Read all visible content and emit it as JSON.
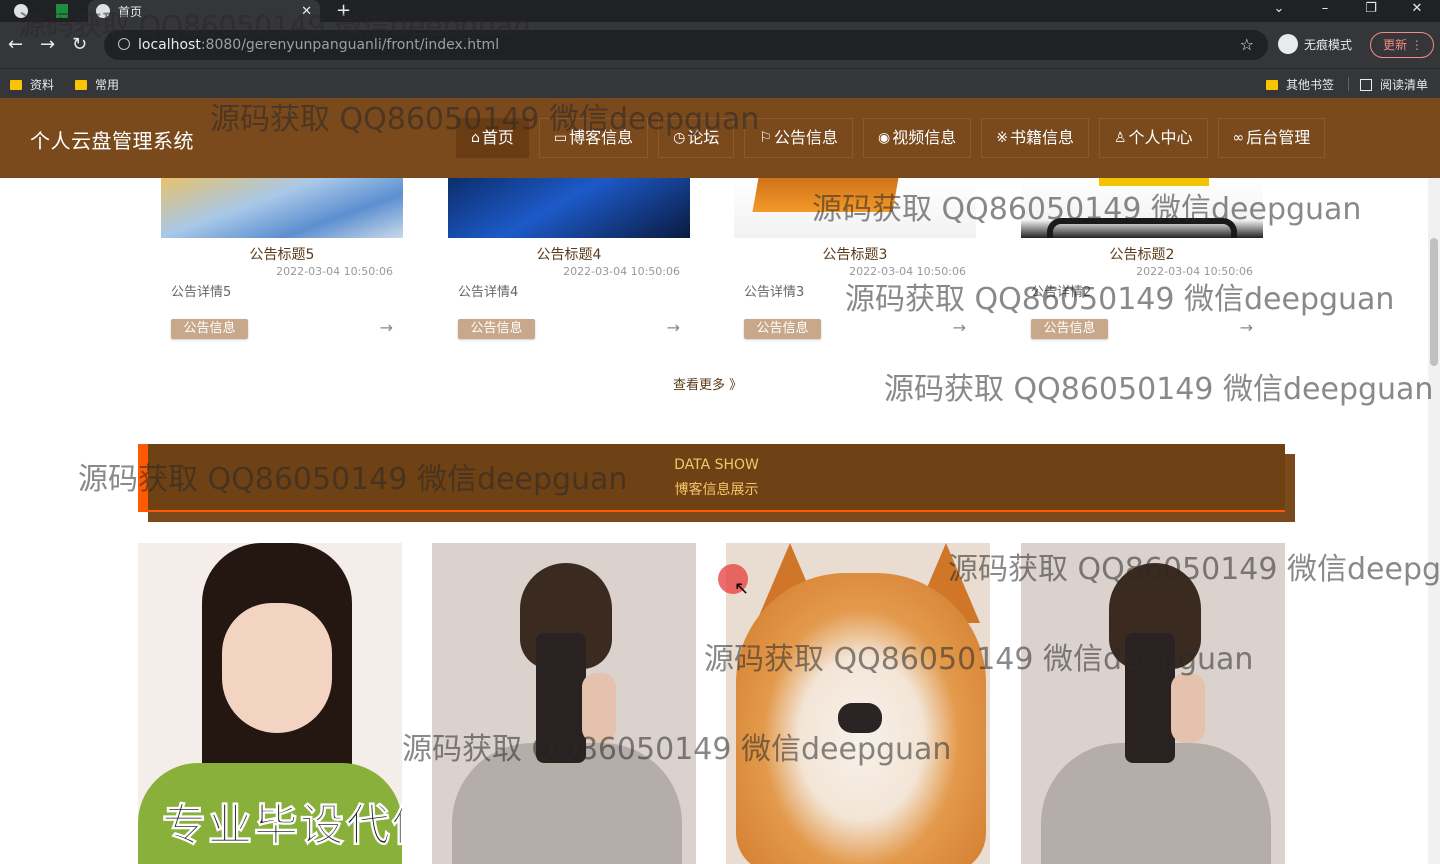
{
  "browser": {
    "tab_title": "首页",
    "url_host": "localhost",
    "url_path": ":8080/gerenyunpanguanli/front/index.html",
    "incognito_label": "无痕模式",
    "update_label": "更新",
    "bookmarks": [
      "资料",
      "常用"
    ],
    "bookmarks_right": [
      "其他书签",
      "阅读清单"
    ]
  },
  "site": {
    "title": "个人云盘管理系统",
    "nav": [
      {
        "label": "首页",
        "icon": "home-icon",
        "glyph": "⌂"
      },
      {
        "label": "博客信息",
        "icon": "blog-icon",
        "glyph": "▭"
      },
      {
        "label": "论坛",
        "icon": "forum-icon",
        "glyph": "◷"
      },
      {
        "label": "公告信息",
        "icon": "flag-icon",
        "glyph": "⚐"
      },
      {
        "label": "视频信息",
        "icon": "video-icon",
        "glyph": "◉"
      },
      {
        "label": "书籍信息",
        "icon": "book-icon",
        "glyph": "※"
      },
      {
        "label": "个人中心",
        "icon": "user-icon",
        "glyph": "♙"
      },
      {
        "label": "后台管理",
        "icon": "link-icon",
        "glyph": "∞"
      }
    ]
  },
  "notices": [
    {
      "title": "公告标题5",
      "date": "2022-03-04 10:50:06",
      "desc": "公告详情5",
      "tag": "公告信息"
    },
    {
      "title": "公告标题4",
      "date": "2022-03-04 10:50:06",
      "desc": "公告详情4",
      "tag": "公告信息"
    },
    {
      "title": "公告标题3",
      "date": "2022-03-04 10:50:06",
      "desc": "公告详情3",
      "tag": "公告信息"
    },
    {
      "title": "公告标题2",
      "date": "2022-03-04 10:50:06",
      "desc": "公告详情2",
      "tag": "公告信息"
    }
  ],
  "more_label": "查看更多 》",
  "arrow": "→",
  "banner": {
    "en": "DATA SHOW",
    "zh": "博客信息展示"
  },
  "photo_caption": "专业毕设代做",
  "watermark": "源码获取 QQ86050149 微信deepguan",
  "colors": {
    "header_bg": "#7a4a1c",
    "accent": "#ff5a00",
    "banner_text": "#f4c66a",
    "tag_bg": "#c8a88a"
  }
}
